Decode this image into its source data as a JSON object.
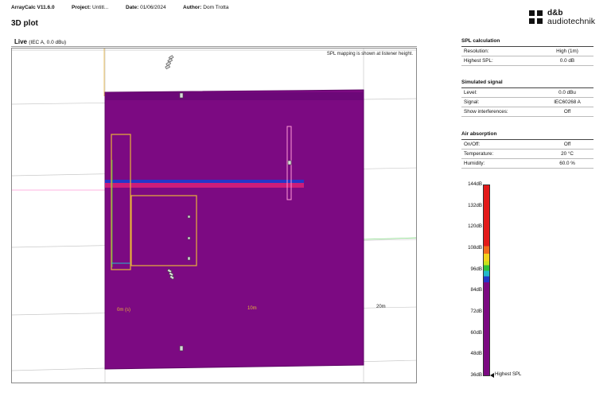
{
  "header": {
    "app": "ArrayCalc V11.6.0",
    "project_label": "Project:",
    "project_value": "Untitl...",
    "date_label": "Date:",
    "date_value": "01/06/2024",
    "author_label": "Author:",
    "author_value": "Dom Trotta"
  },
  "logo": {
    "line1": "d&b",
    "line2": "audiotechnik"
  },
  "page_title": "3D plot",
  "plot": {
    "title": "Live",
    "subtitle": "(IEC A, 0.0 dBu)",
    "note": "SPL mapping is shown at listener height.",
    "distance_labels": [
      "0m (s)",
      "10m",
      "20m"
    ],
    "colors": {
      "field": "#7c0a82",
      "field_edge": "#5e0766",
      "band": "#cc1d79",
      "outline": "#e8b23a"
    }
  },
  "spl_calculation": {
    "title": "SPL calculation",
    "rows": [
      {
        "label": "Resolution:",
        "value": "High (1m)"
      },
      {
        "label": "Highest SPL:",
        "value": "0.0 dB"
      }
    ]
  },
  "simulated_signal": {
    "title": "Simulated signal",
    "rows": [
      {
        "label": "Level:",
        "value": "0.0 dBu"
      },
      {
        "label": "Signal:",
        "value": "IEC60268 A"
      },
      {
        "label": "Show interferences:",
        "value": "Off"
      }
    ]
  },
  "air_absorption": {
    "title": "Air absorption",
    "rows": [
      {
        "label": "On/Off:",
        "value": "Off"
      },
      {
        "label": "Temperature:",
        "value": "20 °C"
      },
      {
        "label": "Humidity:",
        "value": "60.0 %"
      }
    ]
  },
  "scale": {
    "ticks": [
      "144dB",
      "132dB",
      "120dB",
      "108dB",
      "96dB",
      "84dB",
      "72dB",
      "60dB",
      "48dB",
      "36dB"
    ],
    "pointer_label": "Highest SPL",
    "stops": [
      {
        "color": "#e31a1a",
        "from": 0.0,
        "to": 0.36
      },
      {
        "color": "#f26a1c",
        "from": 0.36,
        "to": 0.34
      },
      {
        "color": "#f2d21c",
        "from": 0.34,
        "to": 0.4
      },
      {
        "color": "#c6e21c",
        "from": 0.4,
        "to": 0.42
      },
      {
        "color": "#2fc23a",
        "from": 0.42,
        "to": 0.44
      },
      {
        "color": "#25b9c9",
        "from": 0.44,
        "to": 0.47
      },
      {
        "color": "#2437c9",
        "from": 0.47,
        "to": 0.5
      },
      {
        "color": "#7c0a82",
        "from": 0.5,
        "to": 1.0
      }
    ]
  }
}
